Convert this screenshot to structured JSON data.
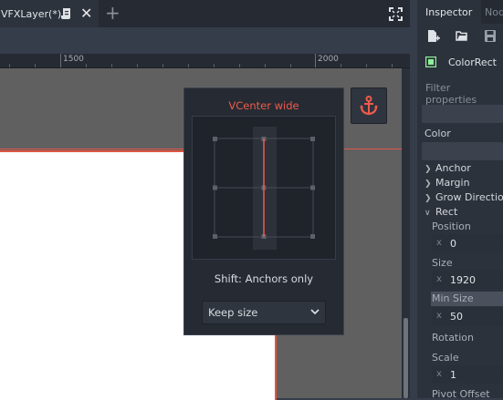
{
  "scene_tab": {
    "label": "VFXLayer(*)"
  },
  "ruler": {
    "labels": [
      "1500",
      "2000"
    ]
  },
  "anchor_popup": {
    "preset_title": "VCenter wide",
    "hint": "Shift: Anchors only",
    "resize_mode": "Keep size"
  },
  "inspector": {
    "tabs": {
      "inspector": "Inspector",
      "node": "Node"
    },
    "node_name": "ColorRect",
    "filter_placeholder": "Filter properties",
    "color_label": "Color",
    "groups": {
      "anchor": "Anchor",
      "margin": "Margin",
      "grow_direction": "Grow Direction",
      "rect": "Rect"
    },
    "rect": {
      "position_label": "Position",
      "position_x": "0",
      "size_label": "Size",
      "size_x": "1920",
      "min_size_label": "Min Size",
      "min_size_x": "50",
      "rotation_label": "Rotation",
      "scale_label": "Scale",
      "scale_x": "1",
      "pivot_offset_label": "Pivot Offset"
    },
    "axis_x": "x"
  },
  "colors": {
    "accent_red": "#ef5a4c",
    "canvas_gray": "#606060",
    "panel_bg": "#2c323c"
  },
  "icons": [
    "script-icon",
    "close-icon",
    "add-tab-icon",
    "fullscreen-icon",
    "anchor-icon",
    "new-resource-icon",
    "open-resource-icon",
    "save-resource-icon",
    "colorrect-icon"
  ]
}
